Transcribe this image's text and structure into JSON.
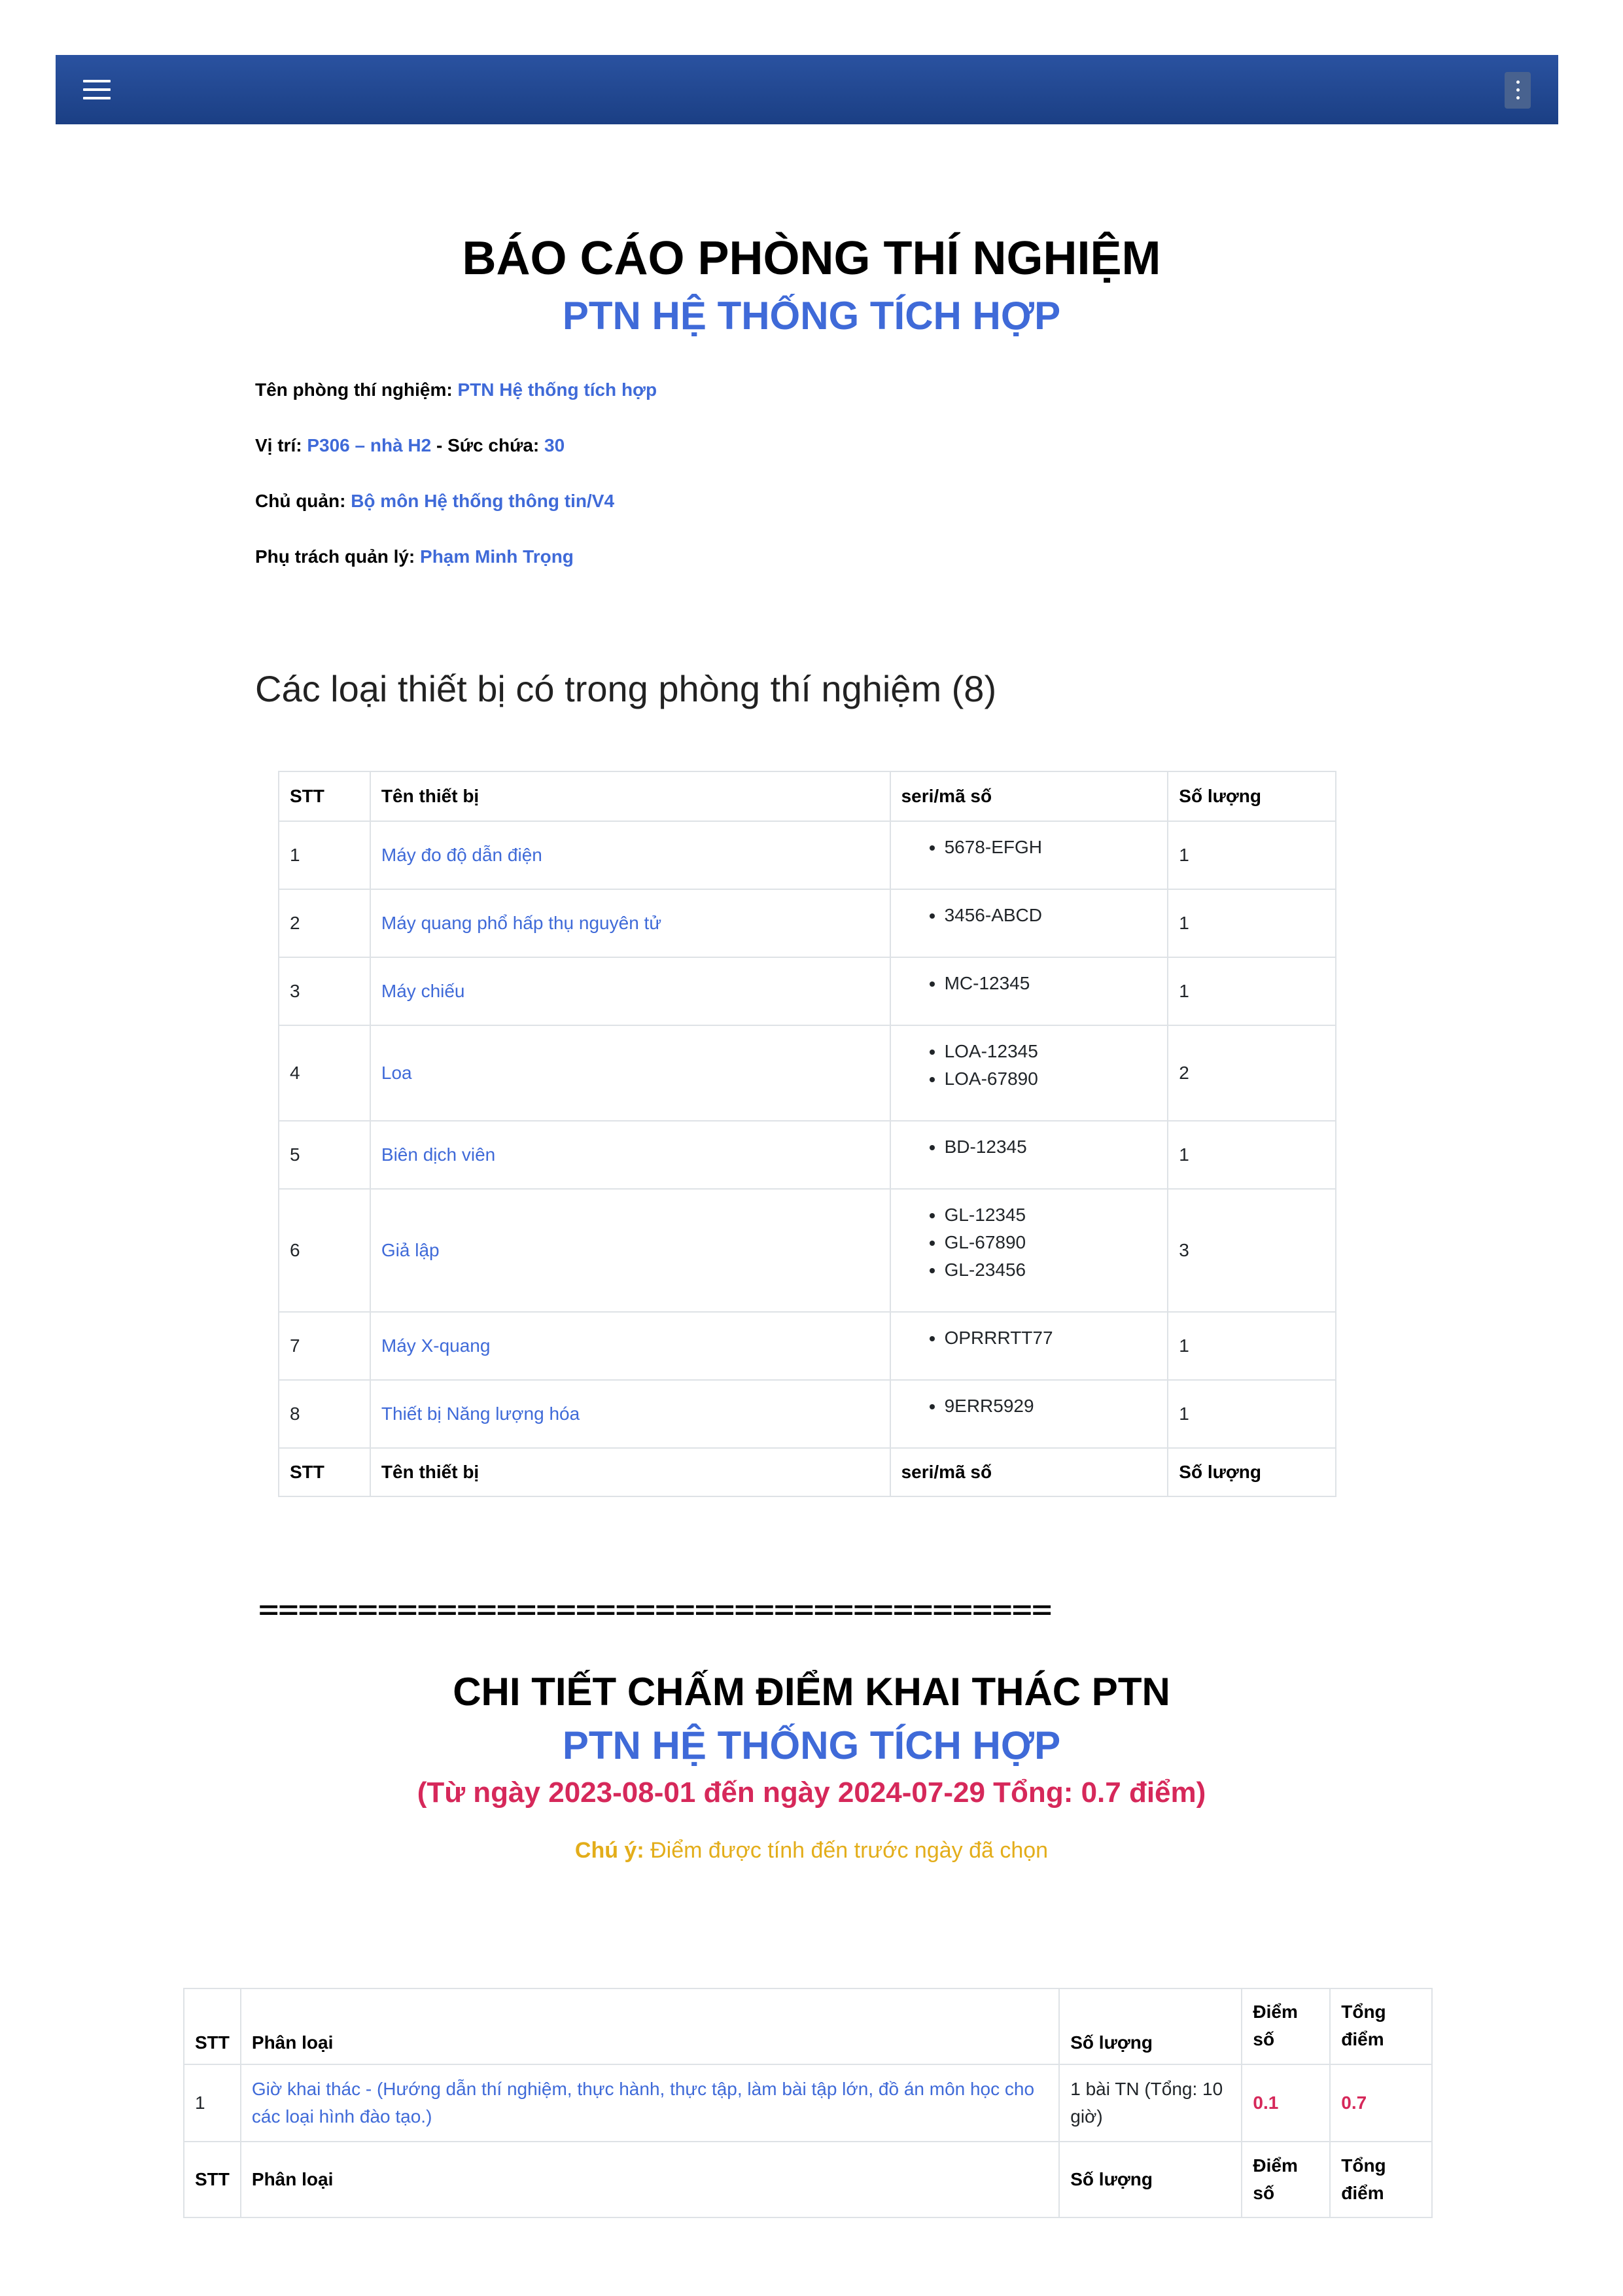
{
  "topbar": {
    "menu_icon": "hamburger-icon",
    "more_icon": "kebab-vertical-icon",
    "color": "#1f4a94"
  },
  "report": {
    "title": "BÁO CÁO PHÒNG THÍ NGHIỆM",
    "subtitle": "PTN HỆ THỐNG TÍCH HỢP",
    "lab_name_label": "Tên phòng thí nghiệm:",
    "lab_name": "PTN Hệ thống tích hợp",
    "location_label": "Vị trí:",
    "location": "P306 – nhà H2",
    "capacity_label": "- Sức chứa:",
    "capacity": "30",
    "owner_label": "Chủ quản:",
    "owner": "Bộ môn Hệ thống thông tin/V4",
    "manager_label": "Phụ trách quản lý:",
    "manager": "Phạm Minh Trọng"
  },
  "equipment": {
    "heading": "Các loại thiết bị có trong phòng thí nghiệm (8)",
    "columns": [
      "STT",
      "Tên thiết bị",
      "seri/mã số",
      "Số lượng"
    ],
    "rows": [
      {
        "stt": "1",
        "name": "Máy đo độ dẫn điện",
        "serials": [
          "5678-EFGH"
        ],
        "qty": "1"
      },
      {
        "stt": "2",
        "name": "Máy quang phổ hấp thụ nguyên tử",
        "serials": [
          "3456-ABCD"
        ],
        "qty": "1"
      },
      {
        "stt": "3",
        "name": "Máy chiếu",
        "serials": [
          "MC-12345"
        ],
        "qty": "1"
      },
      {
        "stt": "4",
        "name": "Loa",
        "serials": [
          "LOA-12345",
          "LOA-67890"
        ],
        "qty": "2"
      },
      {
        "stt": "5",
        "name": "Biên dịch viên",
        "serials": [
          "BD-12345"
        ],
        "qty": "1"
      },
      {
        "stt": "6",
        "name": "Giả lập",
        "serials": [
          "GL-12345",
          "GL-67890",
          "GL-23456"
        ],
        "qty": "3"
      },
      {
        "stt": "7",
        "name": "Máy X-quang",
        "serials": [
          "OPRRRTT77"
        ],
        "qty": "1"
      },
      {
        "stt": "8",
        "name": "Thiết bị Năng lượng hóa",
        "serials": [
          "9ERR5929"
        ],
        "qty": "1"
      }
    ]
  },
  "separator": "========================================",
  "scoring": {
    "title": "CHI TIẾT CHẤM ĐIỂM KHAI THÁC PTN",
    "subtitle": "PTN HỆ THỐNG TÍCH HỢP",
    "range": "(Từ ngày 2023-08-01 đến ngày 2024-07-29 Tổng: 0.7 điểm)",
    "note_label": "Chú ý:",
    "note_text": "Điểm được tính đến trước ngày đã chọn",
    "columns": [
      "STT",
      "Phân loại",
      "Số lượng",
      "Điểm số",
      "Tổng điểm"
    ],
    "rows": [
      {
        "stt": "1",
        "category": "Giờ khai thác - (Hướng dẫn thí nghiệm, thực hành, thực tập, làm bài tập lớn, đồ án môn học cho các loại hình đào tạo.)",
        "qty": "1 bài TN (Tổng: 10 giờ)",
        "points": "0.1",
        "total": "0.7"
      }
    ]
  }
}
